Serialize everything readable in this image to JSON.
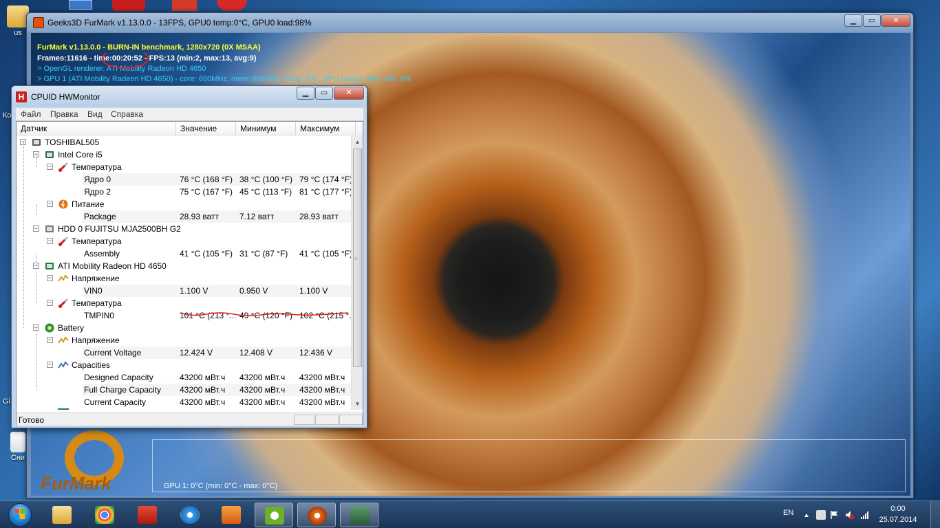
{
  "desktop": {
    "icons": [
      {
        "label": "us"
      },
      {
        "label": "Ко"
      },
      {
        "label": "Gi"
      },
      {
        "label": "Сни"
      }
    ]
  },
  "furmark": {
    "title": "Geeks3D FurMark v1.13.0.0 - 13FPS, GPU0 temp:0°C, GPU0 load:98%",
    "overlay": {
      "line1": "FurMark v1.13.0.0 - BURN-IN benchmark, 1280x720 (0X MSAA)",
      "line2": "Frames:11616 - time:00:20:52 - FPS:13 (min:2, max:13, avg:9)",
      "line3": "> OpenGL renderer: ATI Mobility Radeon HD 4650",
      "line4": "> GPU 1 (ATI Mobility Radeon HD 4650) - core: 600MHz, mem: 800MHz, temp: 0°C, GPU usage: 98%, fan: 0%"
    },
    "graph_label": "GPU 1: 0°C (min: 0°C - max: 0°C)",
    "logo_text": "FurMark"
  },
  "hwmonitor": {
    "title": "CPUID HWMonitor",
    "menu": [
      "Файл",
      "Правка",
      "Вид",
      "Справка"
    ],
    "columns": [
      "Датчик",
      "Значение",
      "Минимум",
      "Максимум"
    ],
    "rows": [
      {
        "label": "TOSHIBAL505",
        "level": 0,
        "icon": "computer-icon",
        "toggle": "−"
      },
      {
        "label": "Intel Core i5",
        "level": 1,
        "icon": "cpu-chip-icon",
        "toggle": "−"
      },
      {
        "label": "Температура",
        "level": 2,
        "icon": "thermometer-icon",
        "toggle": "−"
      },
      {
        "label": "Ядро 0",
        "level": 3,
        "value": "76 °C  (168 °F)",
        "min": "38 °C  (100 °F)",
        "max": "79 °C  (174 °F)"
      },
      {
        "label": "Ядро 2",
        "level": 3,
        "value": "75 °C  (167 °F)",
        "min": "45 °C  (113 °F)",
        "max": "81 °C  (177 °F)"
      },
      {
        "label": "Питание",
        "level": 2,
        "icon": "power-icon",
        "toggle": "−"
      },
      {
        "label": "Package",
        "level": 3,
        "value": "28.93 ватт",
        "min": "7.12 ватт",
        "max": "28.93 ватт"
      },
      {
        "label": "HDD 0 FUJITSU MJA2500BH G2",
        "level": 1,
        "icon": "hard-disk-icon",
        "toggle": "−"
      },
      {
        "label": "Температура",
        "level": 2,
        "icon": "thermometer-icon",
        "toggle": "−"
      },
      {
        "label": "Assembly",
        "level": 3,
        "value": "41 °C  (105 °F)",
        "min": "31 °C  (87 °F)",
        "max": "41 °C  (105 °F)"
      },
      {
        "label": "ATI Mobility Radeon HD 4650",
        "level": 1,
        "icon": "graphics-card-icon",
        "toggle": "−"
      },
      {
        "label": "Напряжение",
        "level": 2,
        "icon": "voltage-icon",
        "toggle": "−"
      },
      {
        "label": "VIN0",
        "level": 3,
        "value": "1.100 V",
        "min": "0.950 V",
        "max": "1.100 V"
      },
      {
        "label": "Температура",
        "level": 2,
        "icon": "thermometer-icon",
        "toggle": "−"
      },
      {
        "label": "TMPIN0",
        "level": 3,
        "value": "101 °C  (213 °...",
        "min": "49 °C  (120 °F)",
        "max": "102 °C  (215 °..."
      },
      {
        "label": "Battery",
        "level": 1,
        "icon": "battery-icon",
        "toggle": "−"
      },
      {
        "label": "Напряжение",
        "level": 2,
        "icon": "voltage-icon",
        "toggle": "−"
      },
      {
        "label": "Current Voltage",
        "level": 3,
        "value": "12.424 V",
        "min": "12.408 V",
        "max": "12.436 V"
      },
      {
        "label": "Capacities",
        "level": 2,
        "icon": "capacity-icon",
        "toggle": "−"
      },
      {
        "label": "Designed Capacity",
        "level": 3,
        "value": "43200 мВт.ч",
        "min": "43200 мВт.ч",
        "max": "43200 мВт.ч"
      },
      {
        "label": "Full Charge Capacity",
        "level": 3,
        "value": "43200 мВт.ч",
        "min": "43200 мВт.ч",
        "max": "43200 мВт.ч"
      },
      {
        "label": "Current Capacity",
        "level": 3,
        "value": "43200 мВт.ч",
        "min": "43200 мВт.ч",
        "max": "43200 мВт.ч"
      }
    ],
    "status": "Готово"
  },
  "taskbar": {
    "apps": [
      {
        "name": "explorer-icon",
        "active": false
      },
      {
        "name": "chrome-icon",
        "active": false
      },
      {
        "name": "flash-icon",
        "active": false
      },
      {
        "name": "internet-explorer-icon",
        "active": false
      },
      {
        "name": "media-player-icon",
        "active": false
      },
      {
        "name": "utorrent-icon",
        "active": true
      },
      {
        "name": "furmark-icon",
        "active": true
      },
      {
        "name": "hwmonitor-icon",
        "active": true
      }
    ],
    "tray": {
      "language": "EN",
      "time": "0:00",
      "date": "25.07.2014"
    }
  },
  "colors": {
    "overlay_yellow": "#ffff33",
    "overlay_cyan": "#33ccff",
    "annotation_red": "#e02020"
  }
}
